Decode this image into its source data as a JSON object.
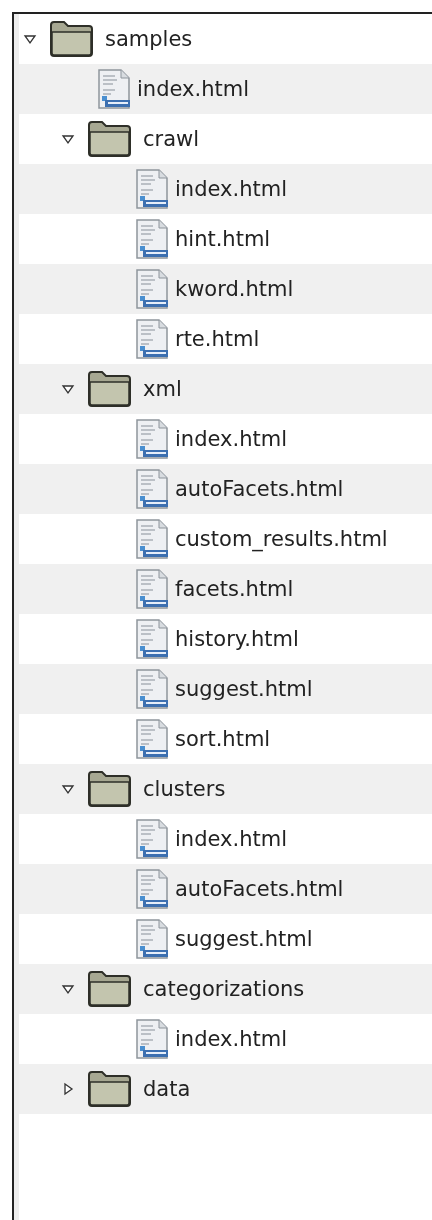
{
  "tree": [
    {
      "kind": "folder",
      "label": "samples",
      "expanded": true,
      "children": [
        {
          "kind": "file",
          "label": "index.html"
        },
        {
          "kind": "folder",
          "label": "crawl",
          "expanded": true,
          "children": [
            {
              "kind": "file",
              "label": "index.html"
            },
            {
              "kind": "file",
              "label": "hint.html"
            },
            {
              "kind": "file",
              "label": "kword.html"
            },
            {
              "kind": "file",
              "label": "rte.html"
            }
          ]
        },
        {
          "kind": "folder",
          "label": "xml",
          "expanded": true,
          "children": [
            {
              "kind": "file",
              "label": "index.html"
            },
            {
              "kind": "file",
              "label": "autoFacets.html"
            },
            {
              "kind": "file",
              "label": "custom_results.html"
            },
            {
              "kind": "file",
              "label": "facets.html"
            },
            {
              "kind": "file",
              "label": "history.html"
            },
            {
              "kind": "file",
              "label": "suggest.html"
            },
            {
              "kind": "file",
              "label": "sort.html"
            }
          ]
        },
        {
          "kind": "folder",
          "label": "clusters",
          "expanded": true,
          "children": [
            {
              "kind": "file",
              "label": "index.html"
            },
            {
              "kind": "file",
              "label": "autoFacets.html"
            },
            {
              "kind": "file",
              "label": "suggest.html"
            }
          ]
        },
        {
          "kind": "folder",
          "label": "categorizations",
          "expanded": true,
          "children": [
            {
              "kind": "file",
              "label": "index.html"
            }
          ]
        },
        {
          "kind": "folder",
          "label": "data",
          "expanded": false
        }
      ]
    }
  ]
}
